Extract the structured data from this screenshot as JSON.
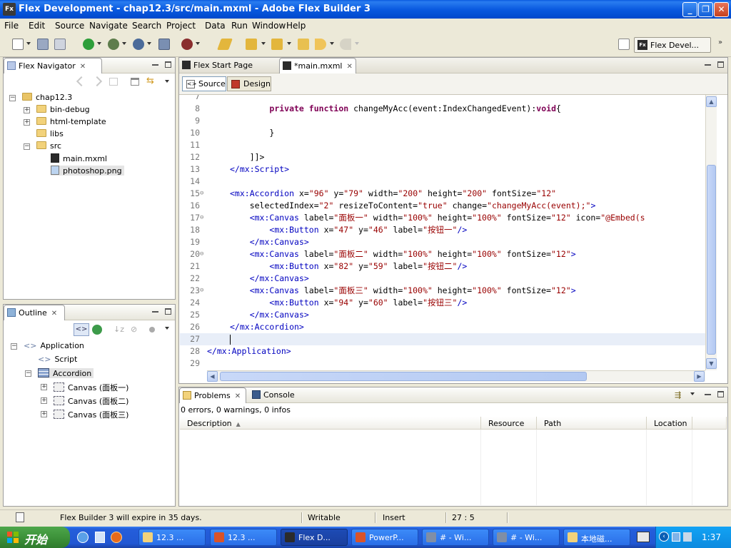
{
  "window": {
    "title": "Flex Development - chap12.3/src/main.mxml - Adobe Flex Builder 3",
    "app_icon": "Fx",
    "buttons": {
      "minimize": "_",
      "restore": "❐",
      "close": "✕"
    }
  },
  "menu": [
    "File",
    "Edit",
    "Source",
    "Navigate",
    "Search",
    "Project",
    "Data",
    "Run",
    "Window",
    "Help"
  ],
  "perspective": {
    "icon": "Fx",
    "label": "Flex Devel..."
  },
  "navigator": {
    "tab_label": "Flex Navigator",
    "items": [
      {
        "label": "chap12.3",
        "type": "project",
        "expander": "−"
      },
      {
        "label": "bin-debug",
        "type": "folder",
        "expander": "+"
      },
      {
        "label": "html-template",
        "type": "folder",
        "expander": "+"
      },
      {
        "label": "libs",
        "type": "folder",
        "expander": ""
      },
      {
        "label": "src",
        "type": "folder",
        "expander": "−"
      },
      {
        "label": "main.mxml",
        "type": "file",
        "expander": ""
      },
      {
        "label": "photoshop.png",
        "type": "image",
        "expander": ""
      }
    ]
  },
  "outline": {
    "tab_label": "Outline",
    "items": [
      {
        "label": "Application",
        "expander": "−"
      },
      {
        "label": "Script",
        "expander": ""
      },
      {
        "label": "Accordion",
        "expander": "−"
      },
      {
        "label": "Canvas (面板一)",
        "expander": "+"
      },
      {
        "label": "Canvas (面板二)",
        "expander": "+"
      },
      {
        "label": "Canvas (面板三)",
        "expander": "+"
      }
    ]
  },
  "editor": {
    "tabs": [
      {
        "label": "Flex Start Page",
        "active": false
      },
      {
        "label": "*main.mxml",
        "active": true
      }
    ],
    "modes": {
      "source": "Source",
      "design": "Design"
    },
    "lines": [
      {
        "n": "7",
        "fold": "",
        "parts": []
      },
      {
        "n": "8",
        "fold": "",
        "parts": [
          [
            "t",
            "        "
          ],
          [
            "kw",
            "private"
          ],
          [
            "t",
            " "
          ],
          [
            "kw",
            "function"
          ],
          [
            "t",
            " changeMyAcc(event:IndexChangedEvent):"
          ],
          [
            "kw",
            "void"
          ],
          [
            "t",
            "{"
          ]
        ]
      },
      {
        "n": "9",
        "fold": "",
        "parts": []
      },
      {
        "n": "10",
        "fold": "",
        "parts": [
          [
            "t",
            "        }"
          ]
        ]
      },
      {
        "n": "11",
        "fold": "",
        "parts": []
      },
      {
        "n": "12",
        "fold": "",
        "parts": [
          [
            "t",
            "    ]]>"
          ]
        ]
      },
      {
        "n": "13",
        "fold": "",
        "parts": [
          [
            "tag",
            "</mx:Script>"
          ]
        ]
      },
      {
        "n": "14",
        "fold": "",
        "parts": []
      },
      {
        "n": "15",
        "fold": "⊖",
        "parts": [
          [
            "tag",
            "<mx:Accordion"
          ],
          [
            "t",
            " x="
          ],
          [
            "str",
            "\"96\""
          ],
          [
            "t",
            " y="
          ],
          [
            "str",
            "\"79\""
          ],
          [
            "t",
            " width="
          ],
          [
            "str",
            "\"200\""
          ],
          [
            "t",
            " height="
          ],
          [
            "str",
            "\"200\""
          ],
          [
            "t",
            " fontSize="
          ],
          [
            "str",
            "\"12\""
          ]
        ]
      },
      {
        "n": "16",
        "fold": "",
        "parts": [
          [
            "t",
            "    selectedIndex="
          ],
          [
            "str",
            "\"2\""
          ],
          [
            "t",
            " resizeToContent="
          ],
          [
            "str",
            "\"true\""
          ],
          [
            "t",
            " change="
          ],
          [
            "str",
            "\"changeMyAcc(event);\""
          ],
          [
            "tag",
            ">"
          ]
        ]
      },
      {
        "n": "17",
        "fold": "⊖",
        "parts": [
          [
            "t",
            "    "
          ],
          [
            "tag",
            "<mx:Canvas"
          ],
          [
            "t",
            " label="
          ],
          [
            "str",
            "\"面板一\""
          ],
          [
            "t",
            " width="
          ],
          [
            "str",
            "\"100%\""
          ],
          [
            "t",
            " height="
          ],
          [
            "str",
            "\"100%\""
          ],
          [
            "t",
            " fontSize="
          ],
          [
            "str",
            "\"12\""
          ],
          [
            "t",
            " icon="
          ],
          [
            "str",
            "\"@Embed(s"
          ]
        ]
      },
      {
        "n": "18",
        "fold": "",
        "parts": [
          [
            "t",
            "        "
          ],
          [
            "tag",
            "<mx:Button"
          ],
          [
            "t",
            " x="
          ],
          [
            "str",
            "\"47\""
          ],
          [
            "t",
            " y="
          ],
          [
            "str",
            "\"46\""
          ],
          [
            "t",
            " label="
          ],
          [
            "str",
            "\"按钮一\""
          ],
          [
            "tag",
            "/>"
          ]
        ]
      },
      {
        "n": "19",
        "fold": "",
        "parts": [
          [
            "t",
            "    "
          ],
          [
            "tag",
            "</mx:Canvas>"
          ]
        ]
      },
      {
        "n": "20",
        "fold": "⊖",
        "parts": [
          [
            "t",
            "    "
          ],
          [
            "tag",
            "<mx:Canvas"
          ],
          [
            "t",
            " label="
          ],
          [
            "str",
            "\"面板二\""
          ],
          [
            "t",
            " width="
          ],
          [
            "str",
            "\"100%\""
          ],
          [
            "t",
            " height="
          ],
          [
            "str",
            "\"100%\""
          ],
          [
            "t",
            " fontSize="
          ],
          [
            "str",
            "\"12\""
          ],
          [
            "tag",
            ">"
          ]
        ]
      },
      {
        "n": "21",
        "fold": "",
        "parts": [
          [
            "t",
            "        "
          ],
          [
            "tag",
            "<mx:Button"
          ],
          [
            "t",
            " x="
          ],
          [
            "str",
            "\"82\""
          ],
          [
            "t",
            " y="
          ],
          [
            "str",
            "\"59\""
          ],
          [
            "t",
            " label="
          ],
          [
            "str",
            "\"按钮二\""
          ],
          [
            "tag",
            "/>"
          ]
        ]
      },
      {
        "n": "22",
        "fold": "",
        "parts": [
          [
            "t",
            "    "
          ],
          [
            "tag",
            "</mx:Canvas>"
          ]
        ]
      },
      {
        "n": "23",
        "fold": "⊖",
        "parts": [
          [
            "t",
            "    "
          ],
          [
            "tag",
            "<mx:Canvas"
          ],
          [
            "t",
            " label="
          ],
          [
            "str",
            "\"面板三\""
          ],
          [
            "t",
            " width="
          ],
          [
            "str",
            "\"100%\""
          ],
          [
            "t",
            " height="
          ],
          [
            "str",
            "\"100%\""
          ],
          [
            "t",
            " fontSize="
          ],
          [
            "str",
            "\"12\""
          ],
          [
            "tag",
            ">"
          ]
        ]
      },
      {
        "n": "24",
        "fold": "",
        "parts": [
          [
            "t",
            "        "
          ],
          [
            "tag",
            "<mx:Button"
          ],
          [
            "t",
            " x="
          ],
          [
            "str",
            "\"94\""
          ],
          [
            "t",
            " y="
          ],
          [
            "str",
            "\"60\""
          ],
          [
            "t",
            " label="
          ],
          [
            "str",
            "\"按钮三\""
          ],
          [
            "tag",
            "/>"
          ]
        ]
      },
      {
        "n": "25",
        "fold": "",
        "parts": [
          [
            "t",
            "    "
          ],
          [
            "tag",
            "</mx:Canvas>"
          ]
        ]
      },
      {
        "n": "26",
        "fold": "",
        "parts": [
          [
            "tag",
            "</mx:Accordion>"
          ]
        ]
      },
      {
        "n": "27",
        "fold": "",
        "parts": [],
        "current": true
      },
      {
        "n": "28",
        "fold": "",
        "parts": [
          [
            "tag",
            "</mx:Application>"
          ]
        ],
        "indent0": true
      },
      {
        "n": "29",
        "fold": "",
        "parts": []
      }
    ]
  },
  "problems": {
    "tabs": [
      {
        "label": "Problems",
        "active": true
      },
      {
        "label": "Console",
        "active": false
      }
    ],
    "summary": "0 errors, 0 warnings, 0 infos",
    "columns": [
      "Description",
      "Resource",
      "Path",
      "Location"
    ]
  },
  "statusbar": {
    "message": "Flex Builder 3 will expire in 35 days.",
    "writable": "Writable",
    "insert": "Insert",
    "position": "27 : 5"
  },
  "taskbar": {
    "start": "开始",
    "tasks": [
      {
        "label": "12.3 ...",
        "color": "#f2d27b",
        "active": false
      },
      {
        "label": "12.3 ...",
        "color": "#d9532a",
        "active": false
      },
      {
        "label": "Flex D...",
        "color": "#2b2b2b",
        "active": true
      },
      {
        "label": "PowerP...",
        "color": "#d9532a",
        "active": false
      },
      {
        "label": "# - Wi...",
        "color": "#7f8ea6",
        "active": false
      },
      {
        "label": "# - Wi...",
        "color": "#7f8ea6",
        "active": false
      },
      {
        "label": "本地磁...",
        "color": "#f2d27b",
        "active": false
      }
    ],
    "clock": "1:37"
  },
  "colors": {
    "title_blue": "#0a5ae0",
    "tag": "#0000c0",
    "keyword": "#7f0055",
    "string": "#990000",
    "current_line": "#e8eef8"
  }
}
